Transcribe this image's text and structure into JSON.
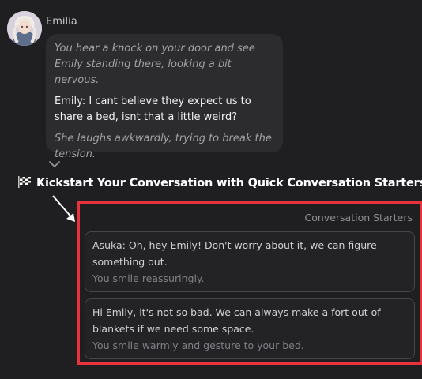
{
  "message": {
    "sender": "Emilia",
    "narration_1": "You hear a knock on your door and see Emily standing there, looking a bit nervous.",
    "speech": "Emily: I cant believe they expect us to share a bed, isnt that a little weird?",
    "narration_2": "She laughs awkwardly, trying to break the tension."
  },
  "expand_icon": "chevron-down",
  "headline": {
    "flag_icon": "checkered-flag",
    "text": "Kickstart Your Conversation with Quick Conversation Starters!"
  },
  "starters": {
    "title": "Conversation Starters",
    "items": [
      {
        "text": "Asuka: Oh, hey Emily! Don't worry about it, we can figure something out.",
        "action": "You smile reassuringly."
      },
      {
        "text": "Hi Emily, it's not so bad. We can always make a fort out of blankets if we need some space.",
        "action": "You smile warmly and gesture to your bed."
      }
    ]
  },
  "colors": {
    "background": "#1f1f21",
    "bubble": "#2c2c2f",
    "highlight_border": "#e8323e"
  }
}
